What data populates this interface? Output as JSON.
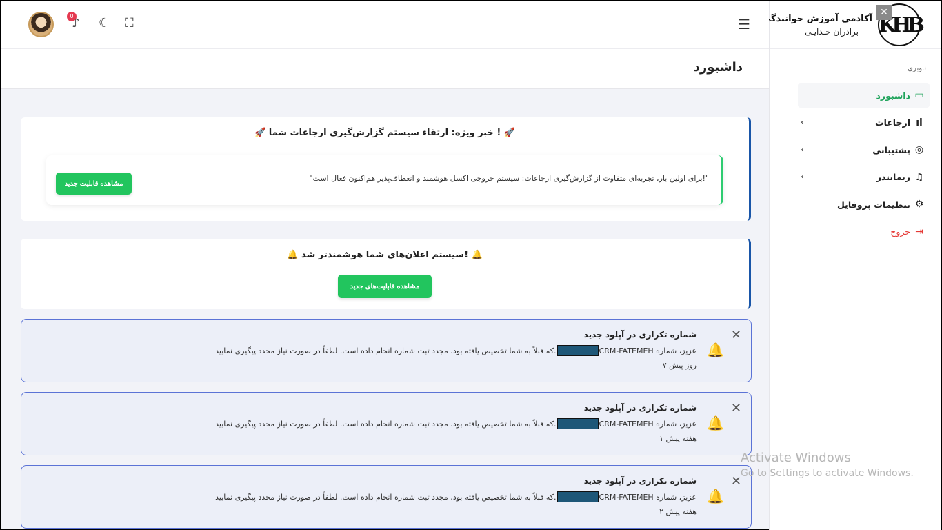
{
  "brand": {
    "title": "آکادمی آموزش خوانندگی",
    "subtitle": "برادران خـدایـی",
    "logo_text": "KHB"
  },
  "sidebar": {
    "caption": "ناوبری",
    "items": [
      {
        "label": "داشبورد",
        "icon": "monitor-icon",
        "active": true
      },
      {
        "label": "ارجاعات",
        "icon": "bar-chart-icon",
        "has_children": true
      },
      {
        "label": "پشتیبانی",
        "icon": "lifebuoy-icon",
        "has_children": true
      },
      {
        "label": "ریمایندر",
        "icon": "bell-icon",
        "has_children": true
      },
      {
        "label": "تنظیمات پروفایل",
        "icon": "gear-icon"
      },
      {
        "label": "خروج",
        "icon": "logout-icon"
      }
    ]
  },
  "topbar": {
    "notification_count": "0"
  },
  "page": {
    "title": "داشبورد"
  },
  "card1": {
    "title": "🚀 خبر ویژه: ارتقاء سیستم گزارش‌گیری ارجاعات شما ! 🚀",
    "text": "\"برای اولین بار، تجربه‌ای متفاوت از گزارش‌گیری ارجاعات: سیستم خروجی اکسل هوشمند و انعطاف‌پذیر هم‌اکنون فعال است!\"",
    "button": "مشاهده قابلیت جدید"
  },
  "card2": {
    "title": "🔔 سیستم اعلان‌های شما هوشمندتر شد! 🔔",
    "button": "مشاهده قابلیت‌های جدید"
  },
  "notifications": [
    {
      "title": "شماره تکراری در آپلود جدید",
      "body_start": "CRM-FATEMEH عزیز، شماره",
      "body_end": "که قبلاً به شما تخصیص یافته بود، مجدد ثبت شماره انجام داده است. لطفاً در صورت نیاز مجدد پیگیری نمایید.",
      "time": "۷ روز پیش"
    },
    {
      "title": "شماره تکراری در آپلود جدید",
      "body_start": "CRM-FATEMEH عزیز، شماره",
      "body_end": "که قبلاً به شما تخصیص یافته بود، مجدد ثبت شماره انجام داده است. لطفاً در صورت نیاز مجدد پیگیری نمایید.",
      "time": "۱ هفته پیش"
    },
    {
      "title": "شماره تکراری در آپلود جدید",
      "body_start": "CRM-FATEMEH عزیز، شماره",
      "body_end": "که قبلاً به شما تخصیص یافته بود، مجدد ثبت شماره انجام داده است. لطفاً در صورت نیاز مجدد پیگیری نمایید.",
      "time": "۲ هفته پیش"
    }
  ],
  "watermark": {
    "line1": "Activate Windows",
    "line2": "Go to Settings to activate Windows."
  }
}
